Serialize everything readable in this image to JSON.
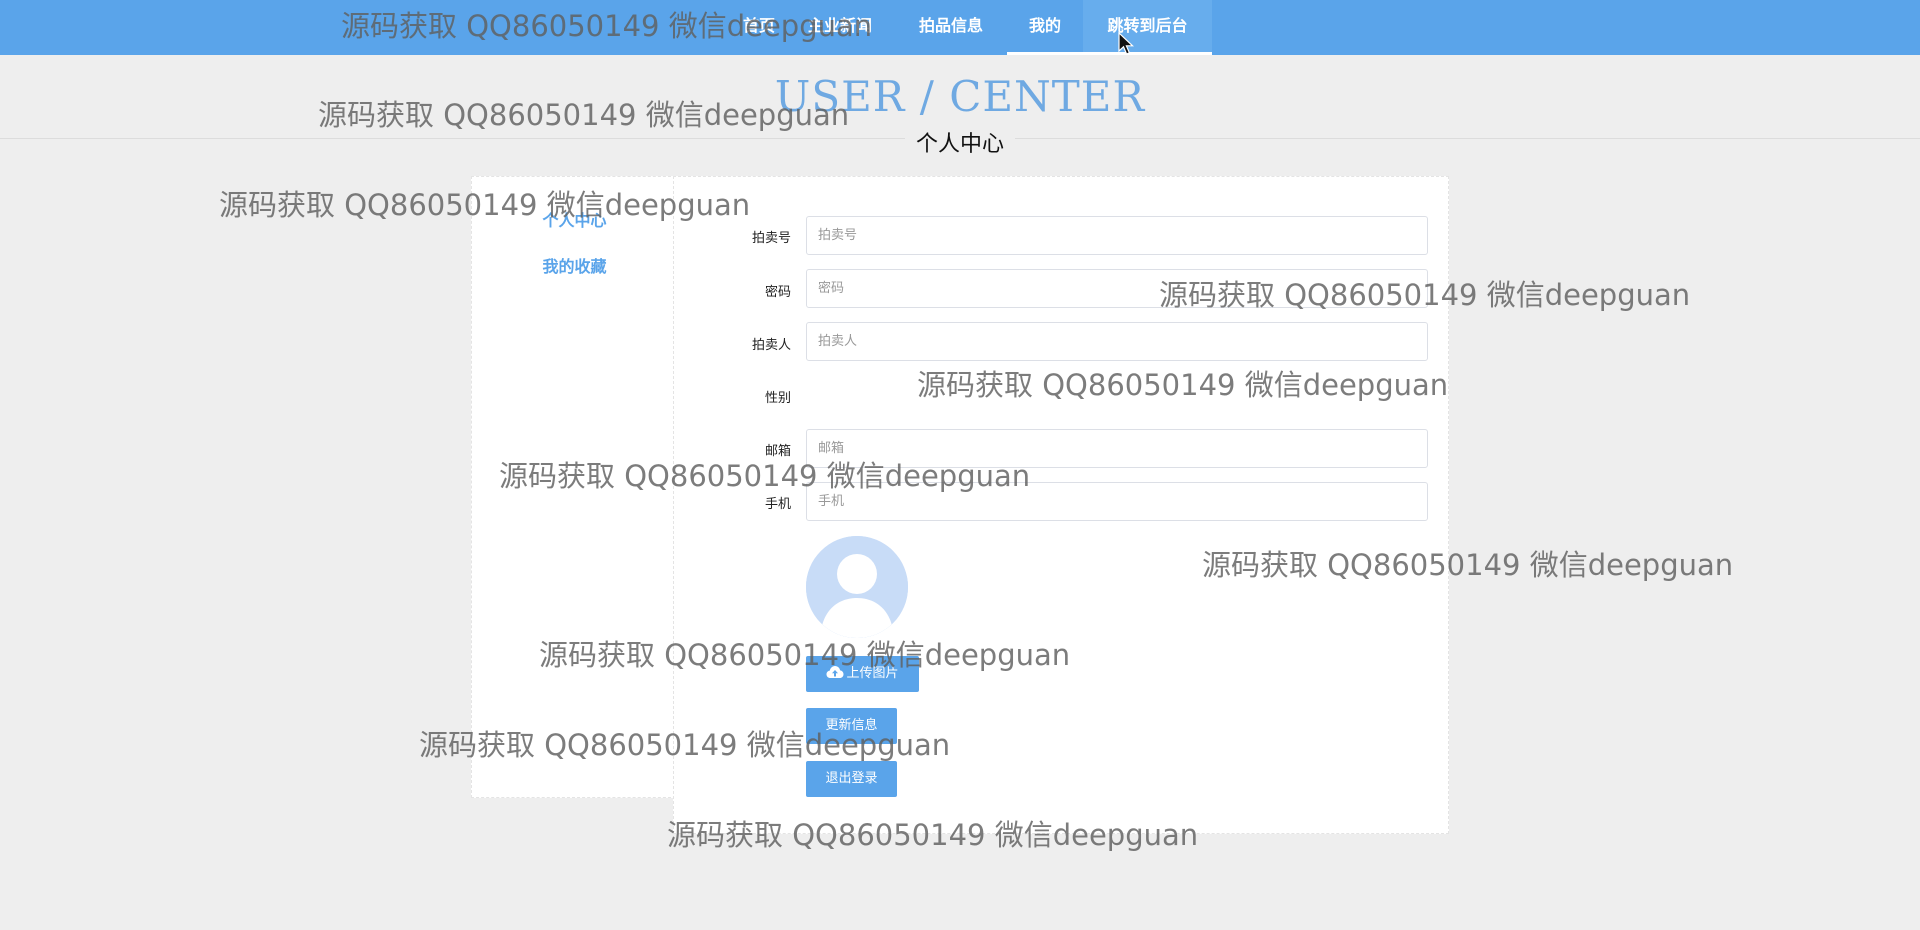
{
  "nav": {
    "items": [
      {
        "label": "首页"
      },
      {
        "label": "主业新闻"
      },
      {
        "label": "拍品信息"
      },
      {
        "label": "我的"
      },
      {
        "label": "跳转到后台"
      }
    ]
  },
  "hero": {
    "title_en": "USER / CENTER",
    "title_cn": "个人中心"
  },
  "sidebar": {
    "items": [
      {
        "label": "个人中心"
      },
      {
        "label": "我的收藏"
      }
    ]
  },
  "form": {
    "fields": [
      {
        "label": "拍卖号",
        "placeholder": "拍卖号",
        "value": ""
      },
      {
        "label": "密码",
        "placeholder": "密码",
        "value": ""
      },
      {
        "label": "拍卖人",
        "placeholder": "拍卖人",
        "value": ""
      },
      {
        "label": "性别"
      },
      {
        "label": "邮箱",
        "placeholder": "邮箱",
        "value": ""
      },
      {
        "label": "手机",
        "placeholder": "手机",
        "value": ""
      }
    ],
    "upload_label": "上传图片",
    "update_label": "更新信息",
    "logout_label": "退出登录"
  },
  "watermark": "源码获取 QQ86050149 微信deepguan",
  "colors": {
    "primary": "#5aa4ea",
    "background": "#eeeeee",
    "hero_text": "#6fa9e2"
  }
}
